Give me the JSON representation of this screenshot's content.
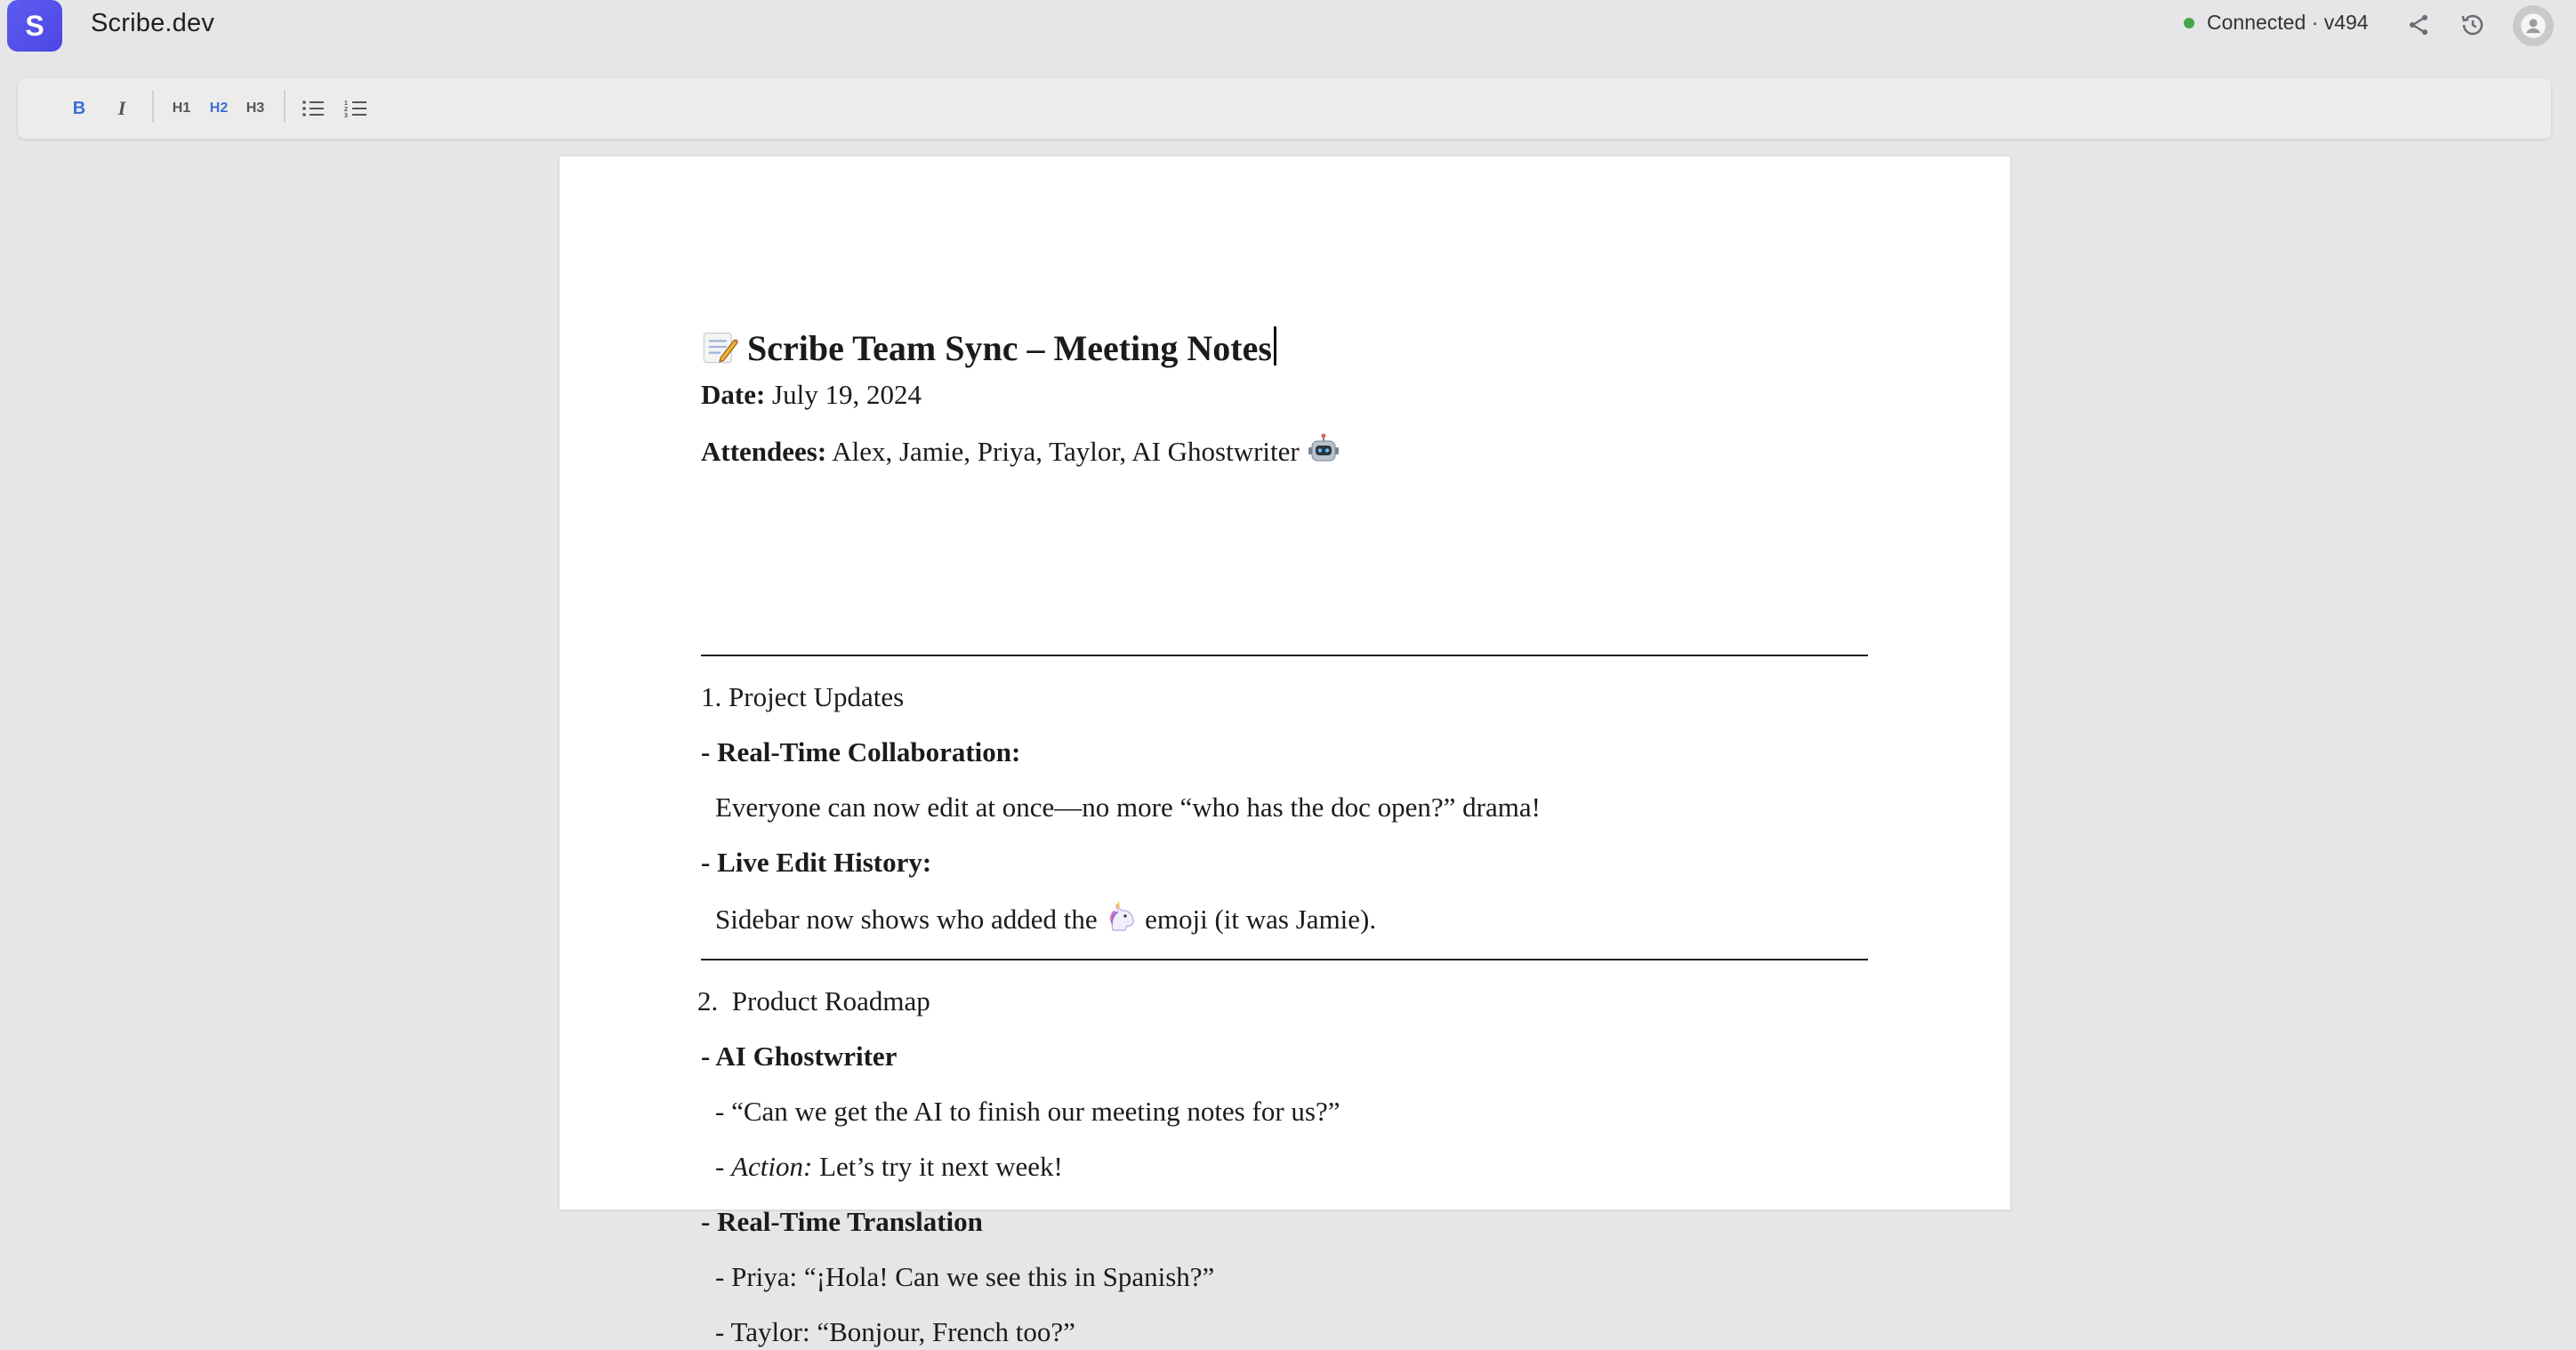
{
  "app": {
    "logo_letter": "S",
    "title": "Scribe.dev",
    "status_text": "Connected · v494",
    "status_color": "#46a54a",
    "accent": "#4f46e5"
  },
  "header_icons": [
    "share-icon",
    "history-icon",
    "account-icon"
  ],
  "toolbar": {
    "bold_label": "B",
    "italic_label": "I",
    "h1_label": "H1",
    "h2_label": "H2",
    "h3_label": "H3",
    "bullet_list_icon": "bullet-list-icon",
    "numbered_list_icon": "numbered-list-icon",
    "active_color": "#3b6fd4"
  },
  "document": {
    "title_emoji": "memo-emoji",
    "title": "Scribe Team Sync – Meeting Notes",
    "date_label": "Date:",
    "date_value": "July 19, 2024",
    "attendees_label": "Attendees:",
    "attendees_value": "Alex, Jamie, Priya, Taylor, AI Ghostwriter",
    "attendees_emoji": "robot-emoji",
    "section1_heading": "1. Project Updates",
    "s1_item1_prefix": "- ",
    "s1_item1_title": "Real-Time Collaboration:",
    "s1_item1_body": "Everyone can now edit at once—no more “who has the doc open?” drama!",
    "s1_item2_prefix": "- ",
    "s1_item2_title": "Live Edit History:",
    "s1_item2_body_before": "Sidebar now shows who added the",
    "s1_item2_emoji": "unicorn-emoji",
    "s1_item2_body_after": "emoji (it was Jamie).",
    "section2_number": "2.",
    "section2_heading": "Product Roadmap",
    "s2_item1_prefix": "- ",
    "s2_item1_title": "AI Ghostwriter",
    "s2_item1_line1": "- “Can we get the AI to finish our meeting notes for us?”",
    "s2_item1_line2_prefix": "- ",
    "s2_item1_line2_label": "Action:",
    "s2_item1_line2_text": " Let’s try it next week!",
    "s2_item2_prefix": "- ",
    "s2_item2_title": "Real-Time Translation",
    "s2_item2_line1": "- Priya: “¡Hola! Can we see this in Spanish?”",
    "s2_item2_line2": "- Taylor: “Bonjour, French too?”"
  }
}
